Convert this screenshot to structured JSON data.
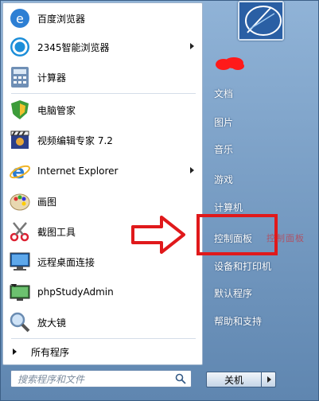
{
  "programs": [
    {
      "label": "百度浏览器",
      "icon": "baidu-browser-icon",
      "arrow": false
    },
    {
      "label": "2345智能浏览器",
      "icon": "2345-browser-icon",
      "arrow": true
    },
    {
      "label": "计算器",
      "icon": "calculator-icon",
      "arrow": false
    },
    {
      "label": "电脑管家",
      "icon": "pc-manager-icon",
      "arrow": false
    },
    {
      "label": "视频编辑专家 7.2",
      "icon": "video-editor-icon",
      "arrow": false
    },
    {
      "label": "Internet Explorer",
      "icon": "internet-explorer-icon",
      "arrow": true
    },
    {
      "label": "画图",
      "icon": "paint-icon",
      "arrow": false
    },
    {
      "label": "截图工具",
      "icon": "snipping-tool-icon",
      "arrow": false
    },
    {
      "label": "远程桌面连接",
      "icon": "remote-desktop-icon",
      "arrow": false
    },
    {
      "label": "phpStudyAdmin",
      "icon": "phpstudy-icon",
      "arrow": false
    },
    {
      "label": "放大镜",
      "icon": "magnifier-icon",
      "arrow": false
    }
  ],
  "all_programs_label": "所有程序",
  "search_placeholder": "搜索程序和文件",
  "right_items": [
    "文档",
    "图片",
    "音乐",
    "游戏",
    "计算机",
    "控制面板",
    "设备和打印机",
    "默认程序",
    "帮助和支持"
  ],
  "shutdown_label": "关机",
  "annotation_text": "控制面板",
  "colors": {
    "highlight": "#e0191b",
    "pane": "#ffffff",
    "sidebar": "#6f96c0"
  }
}
